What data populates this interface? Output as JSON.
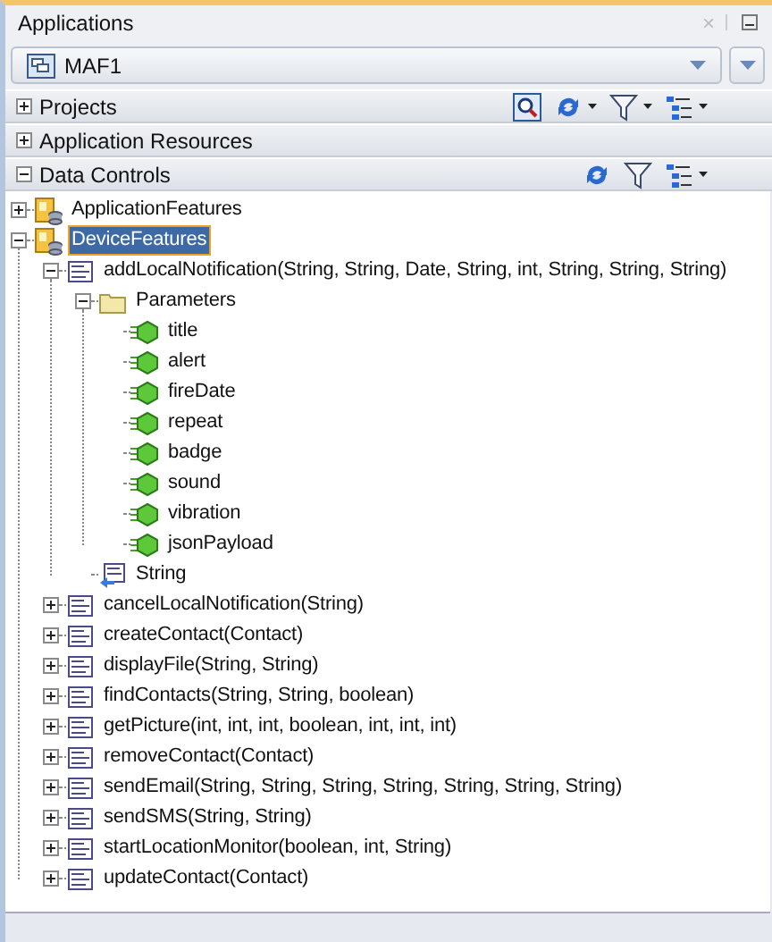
{
  "window": {
    "title": "Applications",
    "close_label": "×"
  },
  "application_selector": {
    "value": "MAF1"
  },
  "sections": [
    {
      "title": "Projects",
      "expanded": false,
      "tools": [
        {
          "kind": "search",
          "menu": false
        },
        {
          "kind": "sync",
          "menu": true
        },
        {
          "kind": "filter",
          "menu": true
        },
        {
          "kind": "layout",
          "menu": true
        }
      ]
    },
    {
      "title": "Application Resources",
      "expanded": false
    },
    {
      "title": "Data Controls",
      "expanded": true,
      "tools": [
        {
          "kind": "sync",
          "menu": false
        },
        {
          "kind": "filter",
          "menu": false
        },
        {
          "kind": "layout",
          "menu": true
        }
      ]
    }
  ],
  "tree": [
    {
      "label": "ApplicationFeatures",
      "kind": "datacontrol",
      "expanded": false,
      "selected": false
    },
    {
      "label": "DeviceFeatures",
      "kind": "datacontrol",
      "expanded": true,
      "selected": true,
      "children": [
        {
          "label": "addLocalNotification(String, String, Date, String, int, String, String, String)",
          "kind": "method",
          "expanded": true,
          "selected": false,
          "children": [
            {
              "label": "Parameters",
              "kind": "folder",
              "expanded": true,
              "selected": false,
              "children": [
                {
                  "label": "title",
                  "kind": "parameter",
                  "selected": false
                },
                {
                  "label": "alert",
                  "kind": "parameter",
                  "selected": false
                },
                {
                  "label": "fireDate",
                  "kind": "parameter",
                  "selected": false
                },
                {
                  "label": "repeat",
                  "kind": "parameter",
                  "selected": false
                },
                {
                  "label": "badge",
                  "kind": "parameter",
                  "selected": false
                },
                {
                  "label": "sound",
                  "kind": "parameter",
                  "selected": false
                },
                {
                  "label": "vibration",
                  "kind": "parameter",
                  "selected": false
                },
                {
                  "label": "jsonPayload",
                  "kind": "parameter",
                  "selected": false
                }
              ]
            },
            {
              "label": "String",
              "kind": "return",
              "selected": false
            }
          ]
        },
        {
          "label": "cancelLocalNotification(String)",
          "kind": "method",
          "expanded": false,
          "selected": false
        },
        {
          "label": "createContact(Contact)",
          "kind": "method",
          "expanded": false,
          "selected": false
        },
        {
          "label": "displayFile(String, String)",
          "kind": "method",
          "expanded": false,
          "selected": false
        },
        {
          "label": "findContacts(String, String, boolean)",
          "kind": "method",
          "expanded": false,
          "selected": false
        },
        {
          "label": "getPicture(int, int, int, boolean, int, int, int)",
          "kind": "method",
          "expanded": false,
          "selected": false
        },
        {
          "label": "removeContact(Contact)",
          "kind": "method",
          "expanded": false,
          "selected": false
        },
        {
          "label": "sendEmail(String, String, String, String, String, String, String)",
          "kind": "method",
          "expanded": false,
          "selected": false
        },
        {
          "label": "sendSMS(String, String)",
          "kind": "method",
          "expanded": false,
          "selected": false
        },
        {
          "label": "startLocationMonitor(boolean, int, String)",
          "kind": "method",
          "expanded": false,
          "selected": false
        },
        {
          "label": "updateContact(Contact)",
          "kind": "method",
          "expanded": false,
          "selected": false
        }
      ]
    }
  ]
}
